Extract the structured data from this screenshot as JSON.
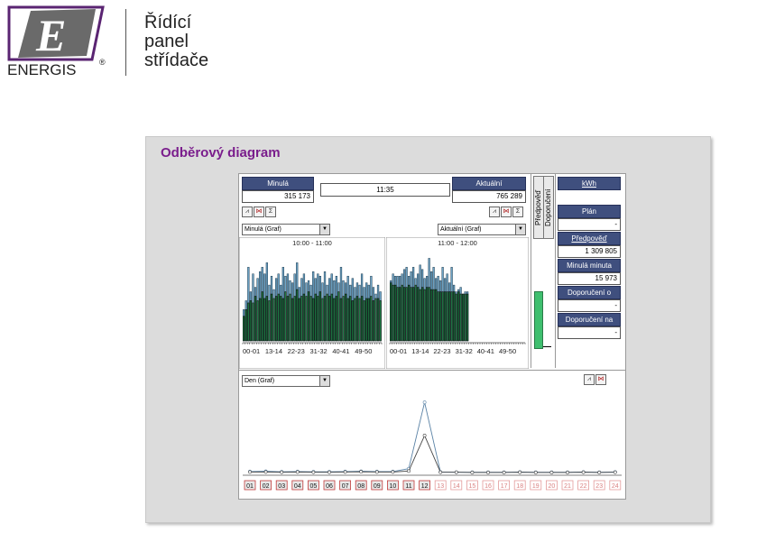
{
  "brand": {
    "name": "ENERGIS",
    "reg": "®",
    "panel_title_lines": [
      "Řídící",
      "panel",
      "střídače"
    ]
  },
  "panel": {
    "title": "Odběrový diagram"
  },
  "left": {
    "header": "Minulá",
    "value": "315 173",
    "chart_select": "Minulá (Graf)",
    "range": "10:00 - 11:00",
    "icons": [
      "chart-bar-icon",
      "chart-line-icon",
      "sum-icon"
    ],
    "x_labels": [
      "00-01",
      "13-14",
      "22-23",
      "31-32",
      "40-41",
      "49-50"
    ]
  },
  "time": "11:35",
  "right": {
    "header": "Aktuální",
    "value": "765 289",
    "chart_select": "Aktuální (Graf)",
    "range": "11:00 - 12:00",
    "icons": [
      "chart-bar-icon",
      "chart-line-icon",
      "sum-icon"
    ],
    "x_labels": [
      "00-01",
      "13-14",
      "22-23",
      "31-32",
      "40-41",
      "49-50"
    ]
  },
  "vertical_tabs": [
    "Předpověď",
    "Doporučení"
  ],
  "side": {
    "unit": "kWh",
    "items": [
      {
        "label": "Plán",
        "value": "-"
      },
      {
        "label": "Předpověď",
        "value": "1 309 805"
      },
      {
        "label": "Minulá minuta",
        "value": "15 973"
      },
      {
        "label": "Doporučení o",
        "value": "-"
      },
      {
        "label": "Doporučení na",
        "value": "-"
      }
    ]
  },
  "day": {
    "chart_select": "Den (Graf)",
    "icons": [
      "chart-bar-icon",
      "chart-line-icon"
    ],
    "hours": [
      "01",
      "02",
      "03",
      "04",
      "05",
      "06",
      "07",
      "08",
      "09",
      "10",
      "11",
      "12",
      "13",
      "14",
      "15",
      "16",
      "17",
      "18",
      "19",
      "20",
      "21",
      "22",
      "23",
      "24"
    ],
    "active_hours": 12
  },
  "colors": {
    "bar": "#1f7a45",
    "bar_edge": "#000000",
    "spike": "#6fa6c8",
    "header": "#3f4f7e",
    "title": "#7a1d8c",
    "gauge": "#3fbf6f",
    "day_active": "#c23b3b"
  },
  "chart_data": [
    {
      "type": "bar",
      "title": "10:00 - 11:00",
      "xlabel": "",
      "ylabel": "",
      "categories": [
        "00-01",
        "13-14",
        "22-23",
        "31-32",
        "40-41",
        "49-50"
      ],
      "values": [
        11,
        14,
        17,
        18,
        17,
        20,
        18,
        19,
        22,
        19,
        20,
        18,
        21,
        19,
        20,
        21,
        20,
        19,
        22,
        20,
        21,
        19,
        20,
        23,
        19,
        20,
        21,
        20,
        22,
        20,
        19,
        21,
        20,
        22,
        19,
        20,
        21,
        20,
        21,
        19,
        20,
        22,
        19,
        20,
        21,
        19,
        20,
        18,
        19,
        20,
        19,
        20,
        18,
        19,
        19,
        20,
        18,
        19,
        19,
        18
      ],
      "peaks": [
        14,
        18,
        33,
        22,
        30,
        24,
        28,
        31,
        33,
        30,
        35,
        25,
        29,
        23,
        28,
        30,
        25,
        33,
        29,
        30,
        27,
        26,
        30,
        35,
        24,
        28,
        30,
        26,
        27,
        25,
        31,
        28,
        30,
        29,
        26,
        31,
        25,
        28,
        30,
        27,
        29,
        26,
        33,
        27,
        26,
        29,
        25,
        28,
        24,
        26,
        25,
        30,
        24,
        26,
        25,
        29,
        24,
        21,
        25,
        22
      ],
      "ylim": [
        0,
        40
      ]
    },
    {
      "type": "bar",
      "title": "11:00 - 12:00",
      "xlabel": "",
      "ylabel": "",
      "categories": [
        "00-01",
        "13-14",
        "22-23",
        "31-32",
        "40-41",
        "49-50"
      ],
      "values": [
        26,
        25,
        25,
        24,
        24,
        25,
        24,
        24,
        25,
        24,
        24,
        25,
        24,
        23,
        24,
        23,
        24,
        24,
        23,
        23,
        23,
        22,
        22,
        22,
        22,
        22,
        22,
        22,
        22,
        21,
        22,
        21,
        21,
        21,
        21,
        0,
        0,
        0,
        0,
        0,
        0,
        0,
        0,
        0,
        0,
        0,
        0,
        0,
        0,
        0,
        0,
        0,
        0,
        0,
        0,
        0,
        0,
        0,
        0,
        0
      ],
      "peaks": [
        27,
        30,
        29,
        29,
        29,
        30,
        32,
        33,
        29,
        31,
        33,
        28,
        30,
        34,
        32,
        28,
        29,
        37,
        31,
        33,
        28,
        29,
        27,
        33,
        28,
        30,
        26,
        33,
        25,
        22,
        23,
        24,
        21,
        22,
        22,
        0,
        0,
        0,
        0,
        0,
        0,
        0,
        0,
        0,
        0,
        0,
        0,
        0,
        0,
        0,
        0,
        0,
        0,
        0,
        0,
        0,
        0,
        0,
        0,
        0
      ],
      "ylim": [
        0,
        40
      ]
    },
    {
      "type": "line",
      "title": "Den (Graf)",
      "xlabel": "",
      "ylabel": "",
      "categories": [
        "01",
        "02",
        "03",
        "04",
        "05",
        "06",
        "07",
        "08",
        "09",
        "10",
        "11",
        "12",
        "13",
        "14",
        "15",
        "16",
        "17",
        "18",
        "19",
        "20",
        "21",
        "22",
        "23",
        "24"
      ],
      "series": [
        {
          "values": [
            0.8,
            0.9,
            0.7,
            0.8,
            0.7,
            0.7,
            0.8,
            0.9,
            0.8,
            0.8,
            2.0,
            30.0,
            0.6,
            0.5,
            0.5,
            0.5,
            0.5,
            0.6,
            0.5,
            0.5,
            0.5,
            0.6,
            0.5,
            0.6
          ]
        },
        {
          "values": [
            0.6,
            0.6,
            0.5,
            0.6,
            0.5,
            0.5,
            0.6,
            0.7,
            0.6,
            0.6,
            1.0,
            16.0,
            0.5,
            0.5,
            0.4,
            0.4,
            0.4,
            0.5,
            0.4,
            0.4,
            0.4,
            0.5,
            0.4,
            0.5
          ]
        }
      ],
      "ylim": [
        0,
        35
      ]
    }
  ]
}
